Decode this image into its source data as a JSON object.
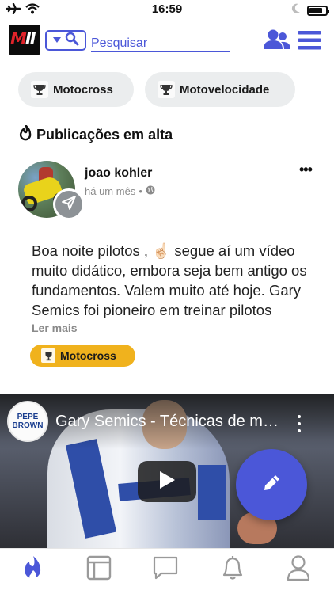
{
  "status_bar": {
    "time": "16:59",
    "icons": [
      "airplane-icon",
      "wifi-icon",
      "moon-icon",
      "battery-icon"
    ],
    "battery_level": 0.8
  },
  "header": {
    "logo": "MII",
    "search": {
      "placeholder": "Pesquisar",
      "toggle_icons": [
        "chevron-down-icon",
        "search-icon"
      ]
    },
    "icons": [
      "people-icon",
      "menu-icon"
    ]
  },
  "categories": [
    {
      "label": "Motocross",
      "icon": "trophy-icon"
    },
    {
      "label": "Motovelocidade",
      "icon": "trophy-icon"
    }
  ],
  "section": {
    "title": "Publicações em alta",
    "icon": "flame-icon"
  },
  "post": {
    "author": "joao kohler",
    "time": "há um mês",
    "visibility_icon": "globe-icon",
    "text": "Boa noite pilotos , ☝🏻 segue aí um vídeo muito didático, embora seja bem antigo os fundamentos. Valem muito até hoje. Gary Semics foi pioneiro em treinar pilotos",
    "read_more": "Ler mais",
    "tag": "Motocross",
    "more_icon": "more-horizontal-icon",
    "share_icon": "send-icon"
  },
  "video": {
    "title": "Gary Semics - Técnicas de motocross",
    "channel": "PEPE BROWN"
  },
  "fab_icon": "pencil-icon",
  "tabbar": [
    {
      "name": "trending",
      "icon": "flame-icon",
      "active": true
    },
    {
      "name": "feed",
      "icon": "layout-icon",
      "active": false
    },
    {
      "name": "messages",
      "icon": "chat-icon",
      "active": false
    },
    {
      "name": "notifications",
      "icon": "bell-icon",
      "active": false
    },
    {
      "name": "profile",
      "icon": "user-icon",
      "active": false
    }
  ],
  "colors": {
    "accent": "#4b57d8",
    "tag": "#f0b21d",
    "chip_bg": "#ebedee"
  }
}
